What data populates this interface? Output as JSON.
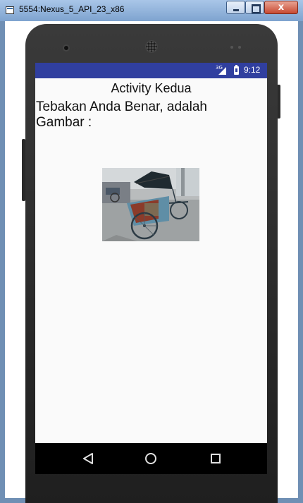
{
  "window": {
    "title": "5554:Nexus_5_API_23_x86",
    "close_glyph": "x"
  },
  "status_bar": {
    "network": "3G",
    "time": "9:12",
    "color": "#303f9f"
  },
  "activity": {
    "title": "Activity Kedua",
    "result_text": "Tebakan Anda Benar, adalah Gambar :"
  },
  "image": {
    "subject": "becak"
  },
  "nav_bar": {
    "icons": [
      "back-icon",
      "home-icon",
      "recent-apps-icon"
    ]
  }
}
